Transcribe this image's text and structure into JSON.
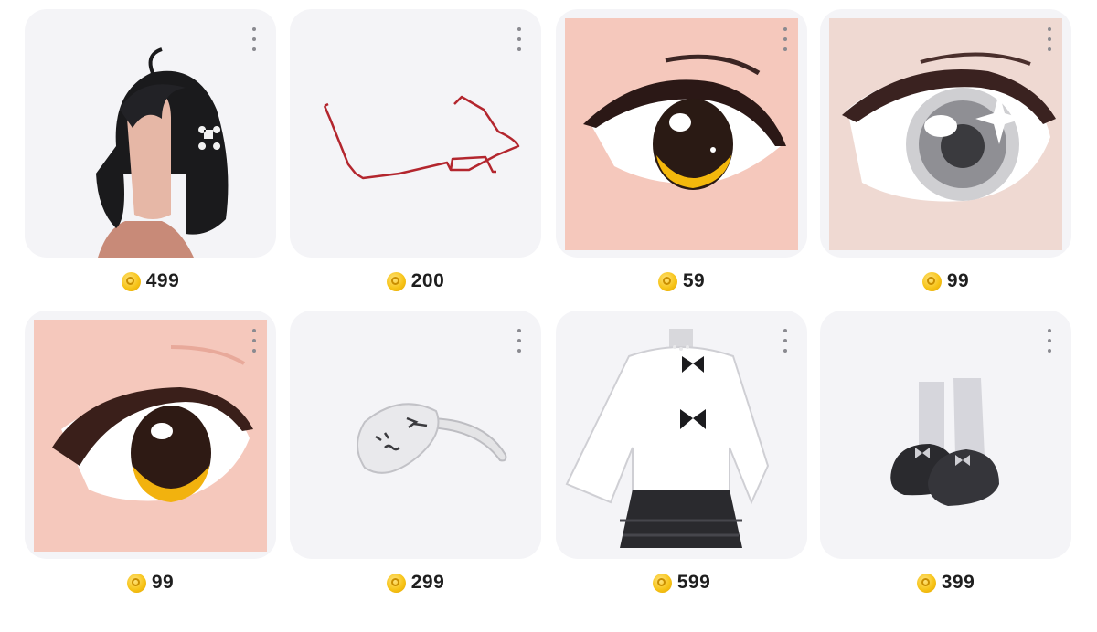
{
  "items": [
    {
      "name": "Short black hair",
      "price": "499",
      "image": "hair-black-bob-icon"
    },
    {
      "name": "Red frame glasses",
      "price": "200",
      "image": "red-glasses-icon"
    },
    {
      "name": "Amber anime eyes",
      "price": "59",
      "image": "amber-eye-icon"
    },
    {
      "name": "Sparkle grey eyes",
      "price": "99",
      "image": "grey-sparkle-eye-icon"
    },
    {
      "name": "Brown anime eyes",
      "price": "99",
      "image": "brown-eye-icon"
    },
    {
      "name": "Cat face headband",
      "price": "299",
      "image": "cat-headband-icon"
    },
    {
      "name": "White sweater with bows",
      "price": "599",
      "image": "sweater-outfit-icon"
    },
    {
      "name": "Black bow slippers",
      "price": "399",
      "image": "slippers-socks-icon"
    }
  ],
  "currency_icon": "coin-icon",
  "menu_icon": "more-vertical-icon",
  "colors": {
    "card_bg": "#f4f4f7",
    "coin": "#f7c418",
    "price_text": "#1e1e1e"
  }
}
